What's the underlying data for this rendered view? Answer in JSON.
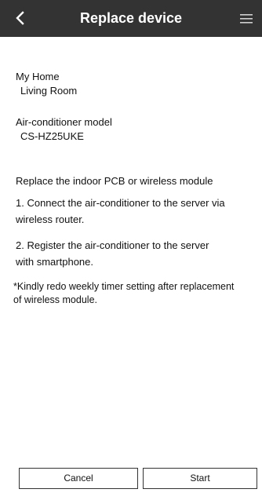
{
  "header": {
    "title": "Replace device",
    "back_icon": "chevron-left-icon",
    "menu_icon": "hamburger-menu-icon"
  },
  "location": {
    "home": "My Home",
    "room": "Living Room"
  },
  "model": {
    "label": "Air-conditioner model",
    "value": "CS-HZ25UKE"
  },
  "instructions": {
    "heading": "Replace the indoor PCB or wireless module",
    "step1_line1": "1. Connect the air-conditioner to the server via",
    "step1_line2": "wireless router.",
    "step2_line1": "2. Register the air-conditioner to the server",
    "step2_line2": "with smartphone.",
    "note_line1": "*Kindly redo weekly timer setting after replacement",
    "note_line2": "of wireless module."
  },
  "buttons": {
    "cancel": "Cancel",
    "start": "Start"
  }
}
